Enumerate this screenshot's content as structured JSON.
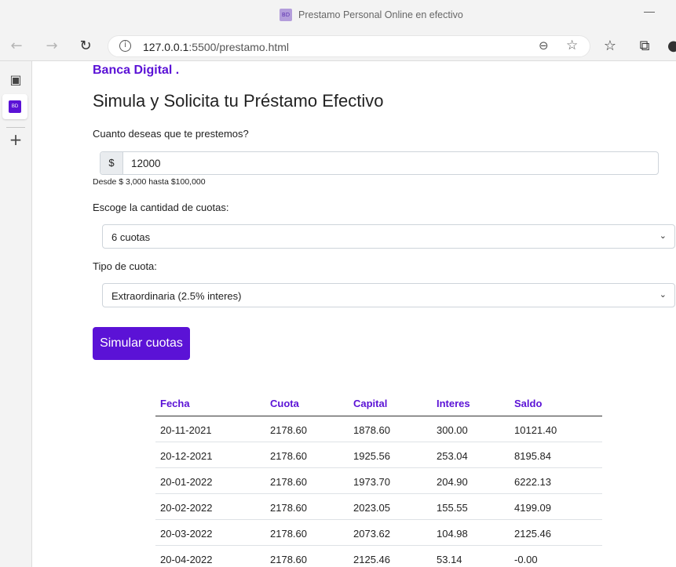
{
  "window": {
    "title": "Prestamo Personal Online en efectivo",
    "favicon_text": "BD"
  },
  "toolbar": {
    "url_host": "127.0.0.1",
    "url_path": ":5500/prestamo.html",
    "back_icon": "back-arrow-icon",
    "forward_icon": "forward-arrow-icon",
    "refresh_icon": "refresh-icon",
    "zoom_icon": "zoom-out-icon",
    "favorite_icon": "add-favorite-icon",
    "favorites_icon": "favorites-icon",
    "collections_icon": "collections-icon"
  },
  "page": {
    "brand": "Banca Digital .",
    "heading": "Simula y Solicita tu Préstamo Efectivo",
    "amount_label": "Cuanto deseas que te prestemos?",
    "amount_prefix": "$",
    "amount_value": "12000",
    "amount_hint": "Desde $ 3,000 hasta $100,000",
    "cuotas_label": "Escoge la cantidad de cuotas:",
    "cuotas_selected": "6 cuotas",
    "tipo_label": "Tipo de cuota:",
    "tipo_selected": "Extraordinaria (2.5% interes)",
    "simulate_button": "Simular cuotas"
  },
  "table": {
    "headers": [
      "Fecha",
      "Cuota",
      "Capital",
      "Interes",
      "Saldo"
    ],
    "rows": [
      [
        "20-11-2021",
        "2178.60",
        "1878.60",
        "300.00",
        "10121.40"
      ],
      [
        "20-12-2021",
        "2178.60",
        "1925.56",
        "253.04",
        "8195.84"
      ],
      [
        "20-01-2022",
        "2178.60",
        "1973.70",
        "204.90",
        "6222.13"
      ],
      [
        "20-02-2022",
        "2178.60",
        "2023.05",
        "155.55",
        "4199.09"
      ],
      [
        "20-03-2022",
        "2178.60",
        "2073.62",
        "104.98",
        "2125.46"
      ],
      [
        "20-04-2022",
        "2178.60",
        "2125.46",
        "53.14",
        "-0.00"
      ]
    ]
  },
  "colors": {
    "accent": "#5b12d6"
  }
}
